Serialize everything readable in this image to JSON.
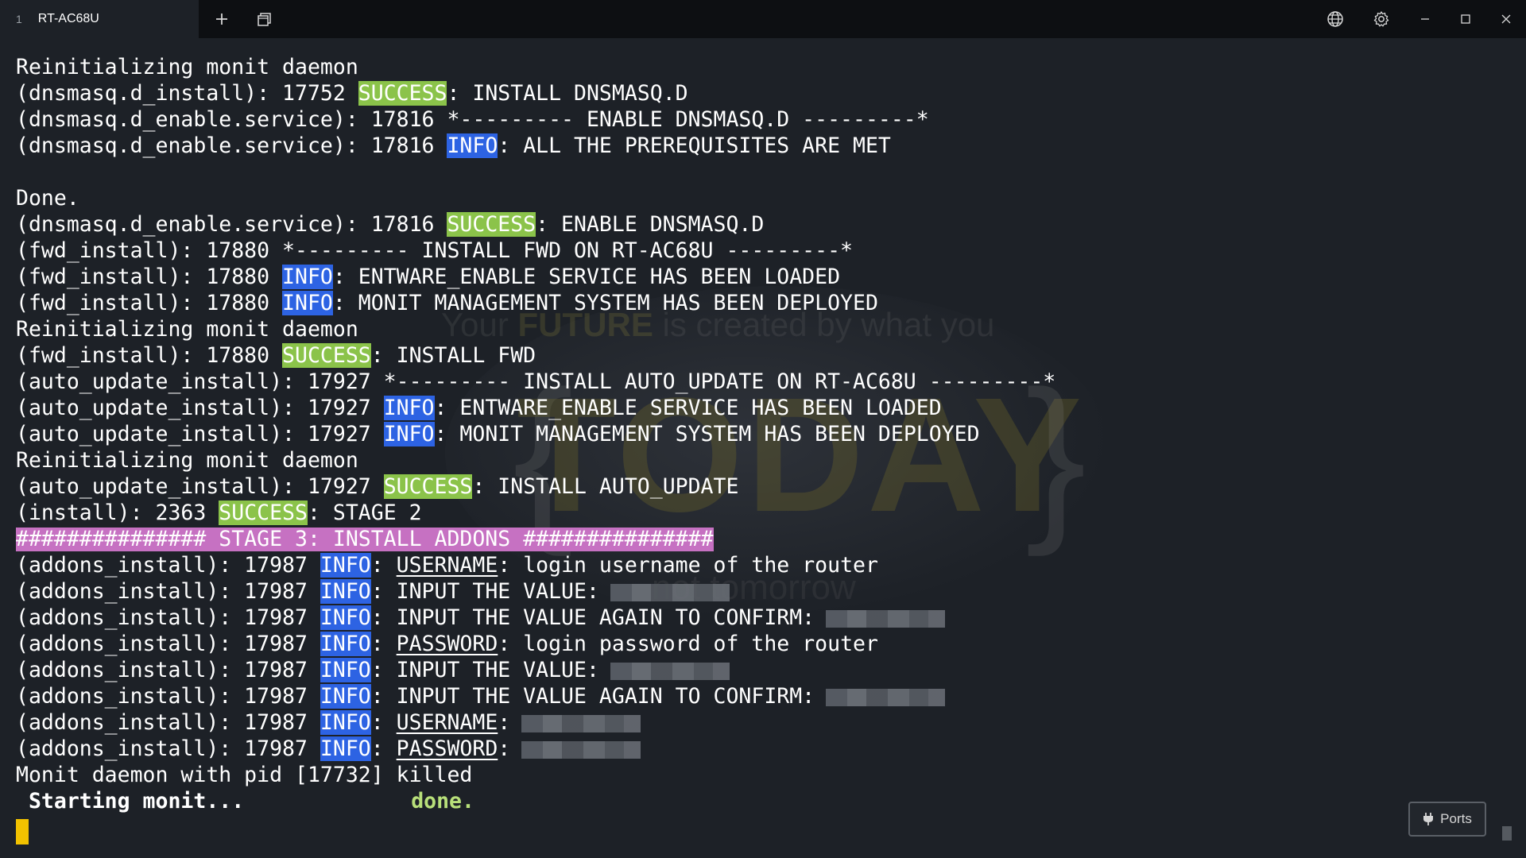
{
  "titlebar": {
    "tab_number": "1",
    "tab_title": "RT-AC68U"
  },
  "watermark": {
    "line1_pre": "Your ",
    "line1_highlight": "FUTURE",
    "line1_post": " is created by what you",
    "brace_left": "{",
    "big_word": "TODAY",
    "brace_right": "}",
    "line3": "not tomorrow"
  },
  "terminal": {
    "lines": [
      {
        "type": "plain",
        "text": "Reinitializing monit daemon"
      },
      {
        "type": "badge",
        "pre": "(dnsmasq.d_install): 17752 ",
        "badge": "SUCCESS",
        "kind": "success",
        "post": ": INSTALL DNSMASQ.D"
      },
      {
        "type": "plain",
        "text": "(dnsmasq.d_enable.service): 17816 *--------- ENABLE DNSMASQ.D ---------*"
      },
      {
        "type": "badge",
        "pre": "(dnsmasq.d_enable.service): 17816 ",
        "badge": "INFO",
        "kind": "info",
        "post": ": ALL THE PREREQUISITES ARE MET"
      },
      {
        "type": "plain",
        "text": ""
      },
      {
        "type": "plain",
        "text": "Done."
      },
      {
        "type": "badge",
        "pre": "(dnsmasq.d_enable.service): 17816 ",
        "badge": "SUCCESS",
        "kind": "success",
        "post": ": ENABLE DNSMASQ.D"
      },
      {
        "type": "plain",
        "text": "(fwd_install): 17880 *--------- INSTALL FWD ON RT-AC68U ---------*"
      },
      {
        "type": "badge",
        "pre": "(fwd_install): 17880 ",
        "badge": "INFO",
        "kind": "info",
        "post": ": ENTWARE_ENABLE SERVICE HAS BEEN LOADED"
      },
      {
        "type": "badge",
        "pre": "(fwd_install): 17880 ",
        "badge": "INFO",
        "kind": "info",
        "post": ": MONIT MANAGEMENT SYSTEM HAS BEEN DEPLOYED"
      },
      {
        "type": "plain",
        "text": "Reinitializing monit daemon"
      },
      {
        "type": "badge",
        "pre": "(fwd_install): 17880 ",
        "badge": "SUCCESS",
        "kind": "success",
        "post": ": INSTALL FWD"
      },
      {
        "type": "plain",
        "text": "(auto_update_install): 17927 *--------- INSTALL AUTO_UPDATE ON RT-AC68U ---------*"
      },
      {
        "type": "badge",
        "pre": "(auto_update_install): 17927 ",
        "badge": "INFO",
        "kind": "info",
        "post": ": ENTWARE_ENABLE SERVICE HAS BEEN LOADED"
      },
      {
        "type": "badge",
        "pre": "(auto_update_install): 17927 ",
        "badge": "INFO",
        "kind": "info",
        "post": ": MONIT MANAGEMENT SYSTEM HAS BEEN DEPLOYED"
      },
      {
        "type": "plain",
        "text": "Reinitializing monit daemon"
      },
      {
        "type": "badge",
        "pre": "(auto_update_install): 17927 ",
        "badge": "SUCCESS",
        "kind": "success",
        "post": ": INSTALL AUTO_UPDATE"
      },
      {
        "type": "badge",
        "pre": "(install): 2363 ",
        "badge": "SUCCESS",
        "kind": "success",
        "post": ": STAGE 2"
      },
      {
        "type": "stage",
        "text": "############### STAGE 3: INSTALL ADDONS ###############"
      },
      {
        "type": "field",
        "pre": "(addons_install): 17987 ",
        "badge": "INFO",
        "sep": ": ",
        "field": "USERNAME",
        "post": ": login username of the router"
      },
      {
        "type": "redacted",
        "pre": "(addons_install): 17987 ",
        "badge": "INFO",
        "post": ": INPUT THE VALUE:"
      },
      {
        "type": "redacted",
        "pre": "(addons_install): 17987 ",
        "badge": "INFO",
        "post": ": INPUT THE VALUE AGAIN TO CONFIRM:"
      },
      {
        "type": "field",
        "pre": "(addons_install): 17987 ",
        "badge": "INFO",
        "sep": ": ",
        "field": "PASSWORD",
        "post": ": login password of the router"
      },
      {
        "type": "redacted",
        "pre": "(addons_install): 17987 ",
        "badge": "INFO",
        "post": ": INPUT THE VALUE:"
      },
      {
        "type": "redacted",
        "pre": "(addons_install): 17987 ",
        "badge": "INFO",
        "post": ": INPUT THE VALUE AGAIN TO CONFIRM:"
      },
      {
        "type": "field_redacted",
        "pre": "(addons_install): 17987 ",
        "badge": "INFO",
        "sep": ": ",
        "field": "USERNAME",
        "post": ":"
      },
      {
        "type": "field_redacted",
        "pre": "(addons_install): 17987 ",
        "badge": "INFO",
        "sep": ": ",
        "field": "PASSWORD",
        "post": ":"
      },
      {
        "type": "plain",
        "text": "Monit daemon with pid [17732] killed"
      },
      {
        "type": "starting",
        "text": " Starting monit...",
        "status": "done."
      }
    ]
  },
  "ports_button": {
    "label": "Ports"
  }
}
